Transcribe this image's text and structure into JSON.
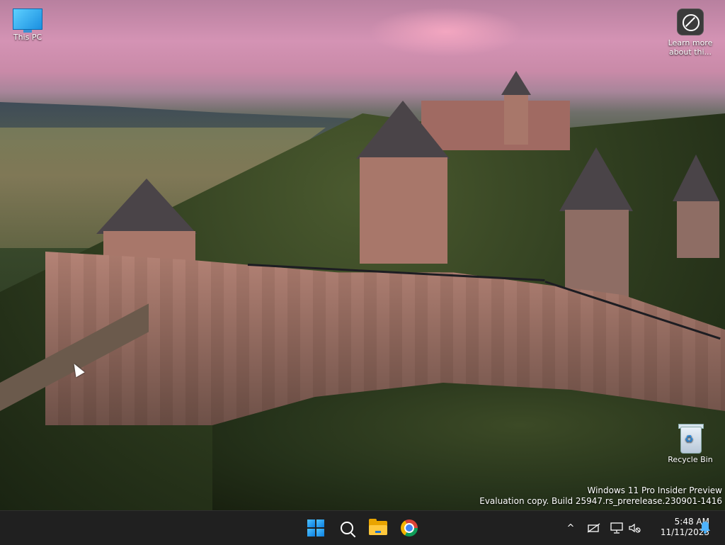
{
  "desktop": {
    "icons": [
      {
        "label": "This PC",
        "icon": "computer-icon"
      },
      {
        "label": "Learn more\nabout thi...",
        "icon": "learn-more-icon"
      },
      {
        "label": "Recycle Bin",
        "icon": "recycle-bin-icon"
      }
    ],
    "watermark": {
      "line1": "Windows 11 Pro Insider Preview",
      "line2": "Evaluation copy. Build 25947.rs_prerelease.230901-1416"
    }
  },
  "taskbar": {
    "pinned": [
      {
        "name": "Start",
        "icon": "windows-logo-icon"
      },
      {
        "name": "Search",
        "icon": "search-icon"
      },
      {
        "name": "File Explorer",
        "icon": "folder-icon"
      },
      {
        "name": "Google Chrome",
        "icon": "chrome-icon"
      }
    ],
    "tray": {
      "overflow": "^",
      "time": "5:48 AM",
      "date": "11/11/2023"
    }
  },
  "colors": {
    "taskbar_bg": "#202020",
    "accent": "#0b7fe0"
  }
}
